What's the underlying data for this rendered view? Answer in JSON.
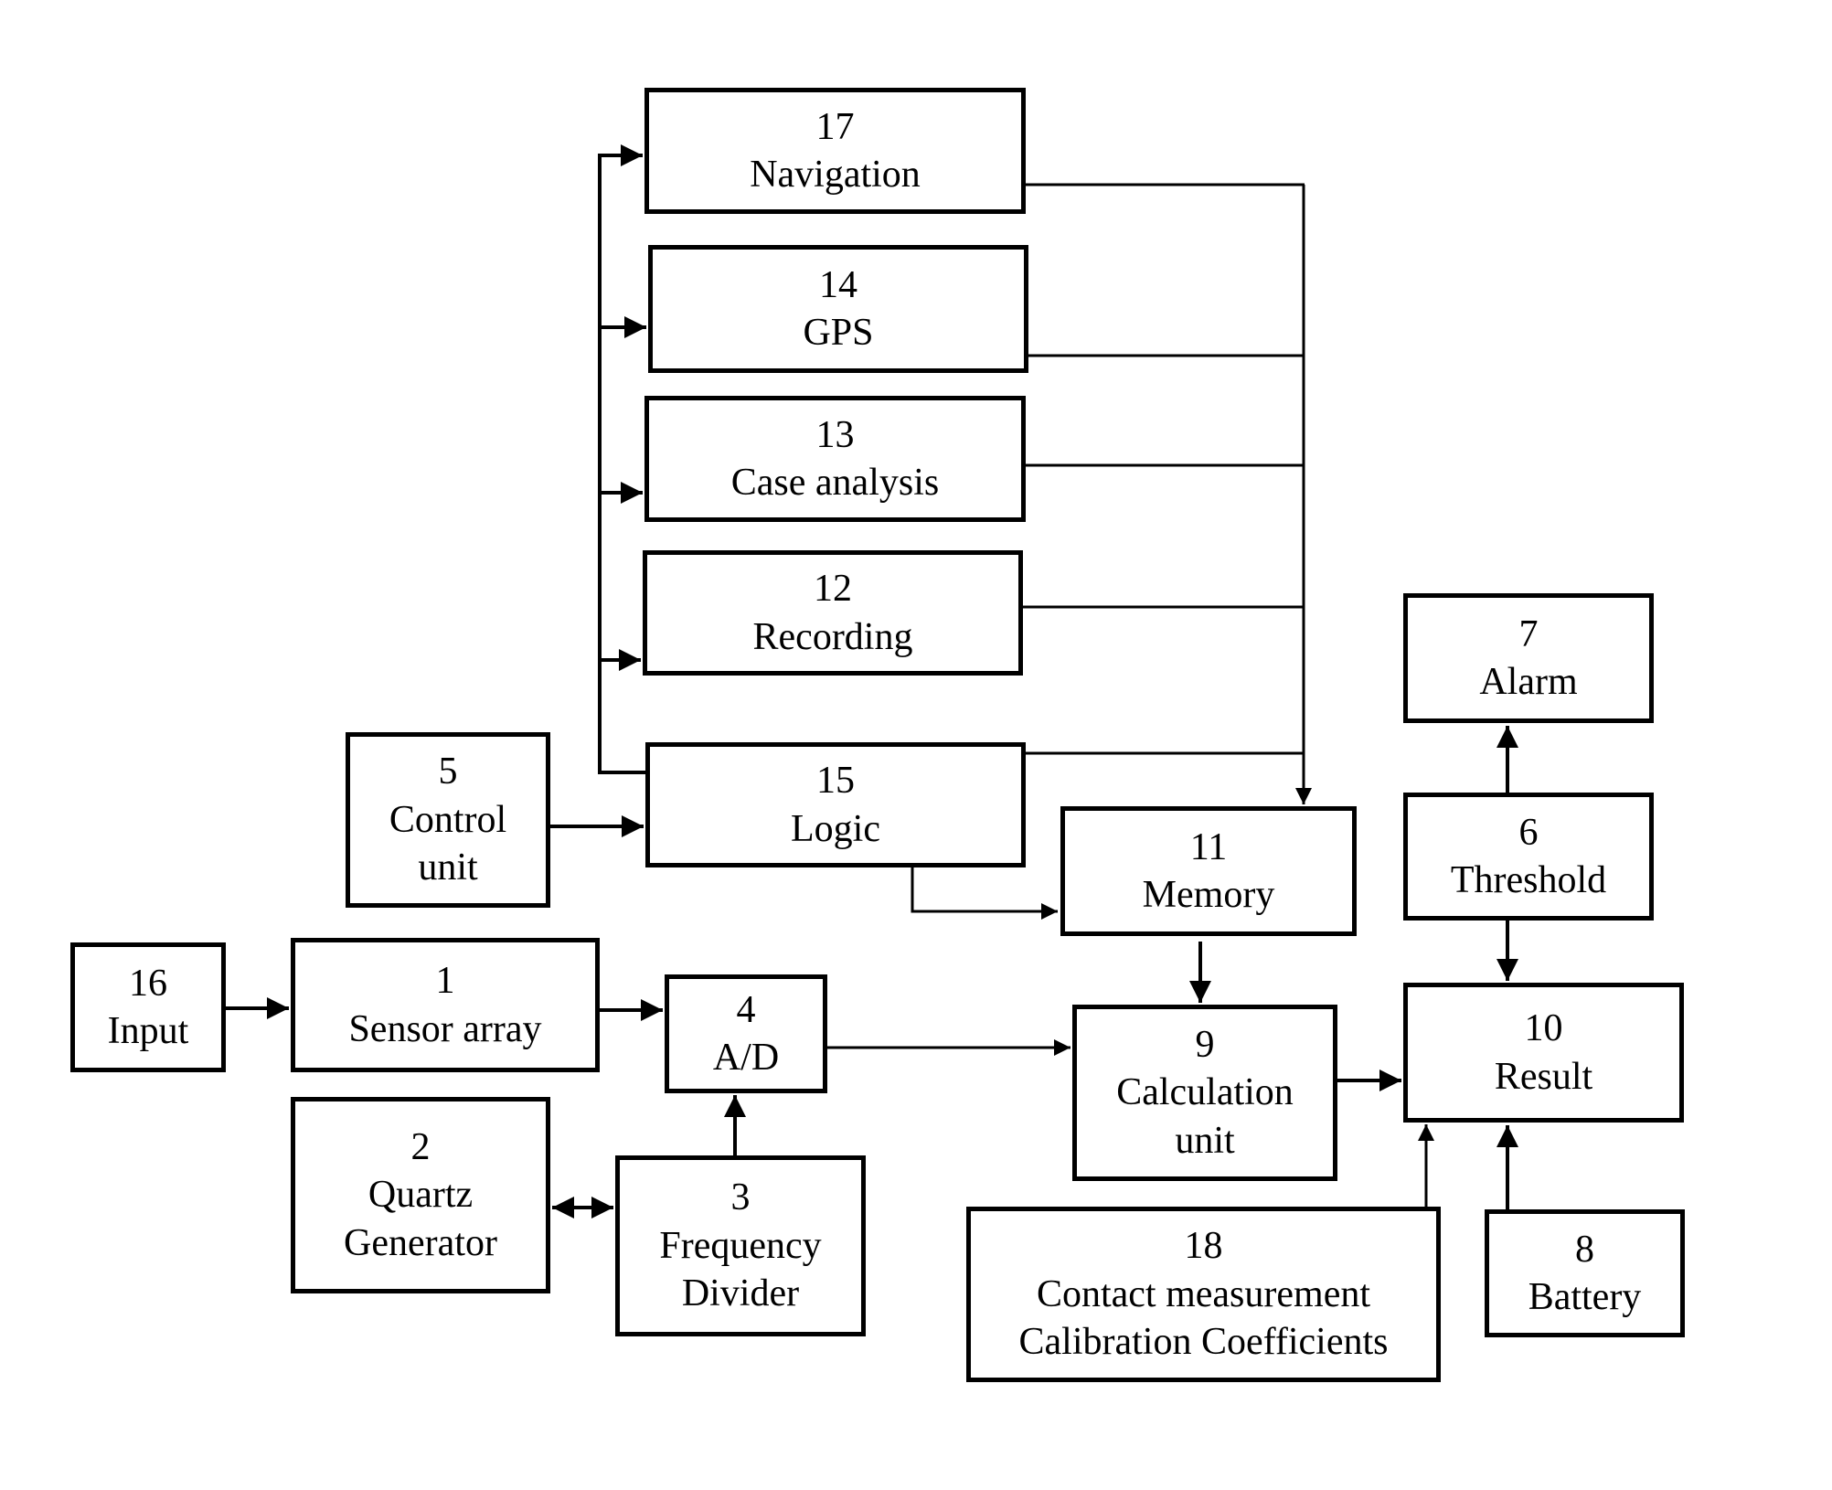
{
  "diagram": {
    "blocks": [
      {
        "id": "17",
        "label": "Navigation"
      },
      {
        "id": "14",
        "label": "GPS"
      },
      {
        "id": "13",
        "label": "Case analysis"
      },
      {
        "id": "12",
        "label": "Recording"
      },
      {
        "id": "15",
        "label": "Logic"
      },
      {
        "id": "5",
        "label": "Control",
        "label2": "unit"
      },
      {
        "id": "11",
        "label": "Memory"
      },
      {
        "id": "7",
        "label": "Alarm"
      },
      {
        "id": "6",
        "label": "Threshold"
      },
      {
        "id": "16",
        "label": "Input"
      },
      {
        "id": "1",
        "label": "Sensor array"
      },
      {
        "id": "4",
        "label": "A/D"
      },
      {
        "id": "9",
        "label": "Calculation",
        "label2": "unit"
      },
      {
        "id": "10",
        "label": "Result"
      },
      {
        "id": "2",
        "label": "Quartz",
        "label2": "Generator"
      },
      {
        "id": "3",
        "label": "Frequency",
        "label2": "Divider"
      },
      {
        "id": "18",
        "label": "Contact measurement",
        "label2": "Calibration Coefficients"
      },
      {
        "id": "8",
        "label": "Battery"
      }
    ],
    "connections": [
      {
        "from": "16",
        "to": "1"
      },
      {
        "from": "1",
        "to": "4"
      },
      {
        "from": "3",
        "to": "4"
      },
      {
        "from": "2",
        "to": "3",
        "bidirectional": true
      },
      {
        "from": "4",
        "to": "9"
      },
      {
        "from": "5",
        "to": "15"
      },
      {
        "from": "15",
        "to": "17"
      },
      {
        "from": "15",
        "to": "14"
      },
      {
        "from": "15",
        "to": "13"
      },
      {
        "from": "15",
        "to": "12"
      },
      {
        "from": "17",
        "to": "11"
      },
      {
        "from": "14",
        "to": "11"
      },
      {
        "from": "13",
        "to": "11"
      },
      {
        "from": "12",
        "to": "11"
      },
      {
        "from": "15",
        "to": "11"
      },
      {
        "from": "11",
        "to": "9"
      },
      {
        "from": "9",
        "to": "10"
      },
      {
        "from": "6",
        "to": "7"
      },
      {
        "from": "6",
        "to": "10"
      },
      {
        "from": "18",
        "to": "10"
      },
      {
        "from": "8",
        "to": "10"
      }
    ]
  }
}
